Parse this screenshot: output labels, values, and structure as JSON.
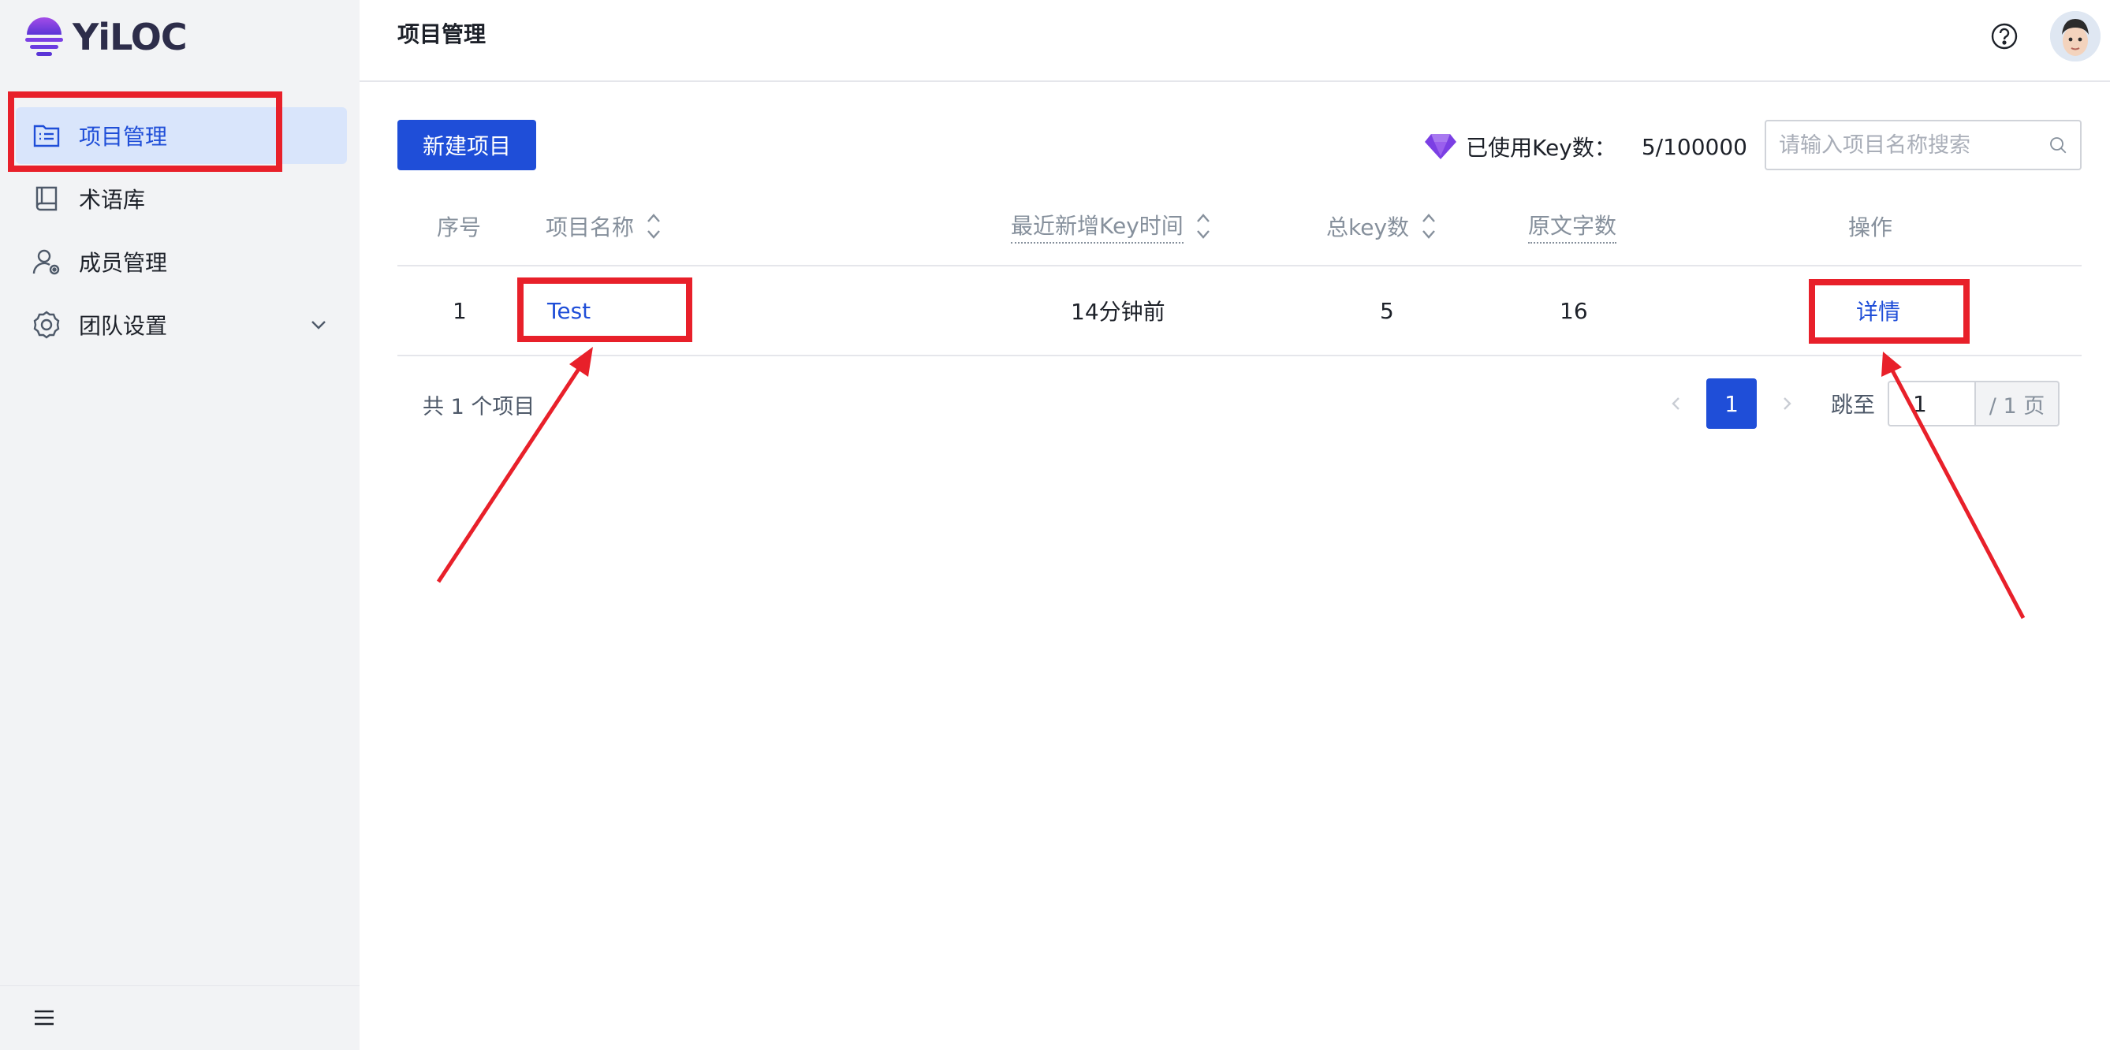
{
  "brand": {
    "name": "YiLOC"
  },
  "sidebar": {
    "items": [
      {
        "label": "项目管理",
        "icon": "list-document-icon",
        "active": true
      },
      {
        "label": "术语库",
        "icon": "book-icon",
        "active": false
      },
      {
        "label": "成员管理",
        "icon": "user-gear-icon",
        "active": false
      },
      {
        "label": "团队设置",
        "icon": "settings-gear-icon",
        "active": false,
        "expandable": true
      }
    ],
    "footer_icon": "menu-icon"
  },
  "header": {
    "title": "项目管理",
    "help_icon": "question-circle-icon",
    "avatar_icon": "user-avatar"
  },
  "toolbar": {
    "new_button_label": "新建项目",
    "usage_label": "已使用Key数：",
    "usage_value": "5/100000",
    "search_placeholder": "请输入项目名称搜索"
  },
  "table": {
    "columns": [
      "序号",
      "项目名称",
      "最近新增Key时间",
      "总key数",
      "原文字数",
      "操作"
    ],
    "rows": [
      {
        "index": "1",
        "name": "Test",
        "last_key_time": "14分钟前",
        "total_keys": "5",
        "source_chars": "16",
        "action": "详情"
      }
    ]
  },
  "pagination": {
    "total_text": "共 1 个项目",
    "current_page": "1",
    "jump_label": "跳至",
    "jump_value": "1",
    "page_suffix": "/ 1 页"
  },
  "colors": {
    "primary": "#1f4ed8",
    "sidebar_bg": "#f2f3f5",
    "active_bg": "#d9e5fb",
    "annotation_red": "#e8202a",
    "brand_purple": "#7b3fe4"
  }
}
